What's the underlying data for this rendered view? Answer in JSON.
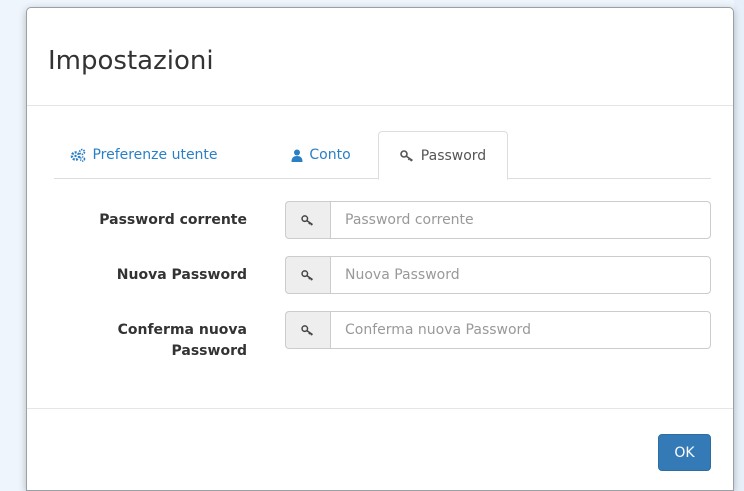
{
  "dialog": {
    "title": "Impostazioni"
  },
  "tabs": [
    {
      "label": "Preferenze utente",
      "icon": "cogs-icon",
      "active": false
    },
    {
      "label": "Conto",
      "icon": "user-icon",
      "active": false
    },
    {
      "label": "Password",
      "icon": "key-icon",
      "active": true
    }
  ],
  "form": {
    "current": {
      "label": "Password corrente",
      "placeholder": "Password corrente",
      "value": ""
    },
    "new": {
      "label": "Nuova Password",
      "placeholder": "Nuova Password",
      "value": ""
    },
    "confirm": {
      "label_line1": "Conferma nuova",
      "label_line2": "Password",
      "placeholder": "Conferma nuova Password",
      "value": ""
    }
  },
  "footer": {
    "ok_label": "OK"
  },
  "colors": {
    "accent": "#337ab7",
    "link": "#2a7fc5",
    "backdrop": "#eef5fc"
  }
}
